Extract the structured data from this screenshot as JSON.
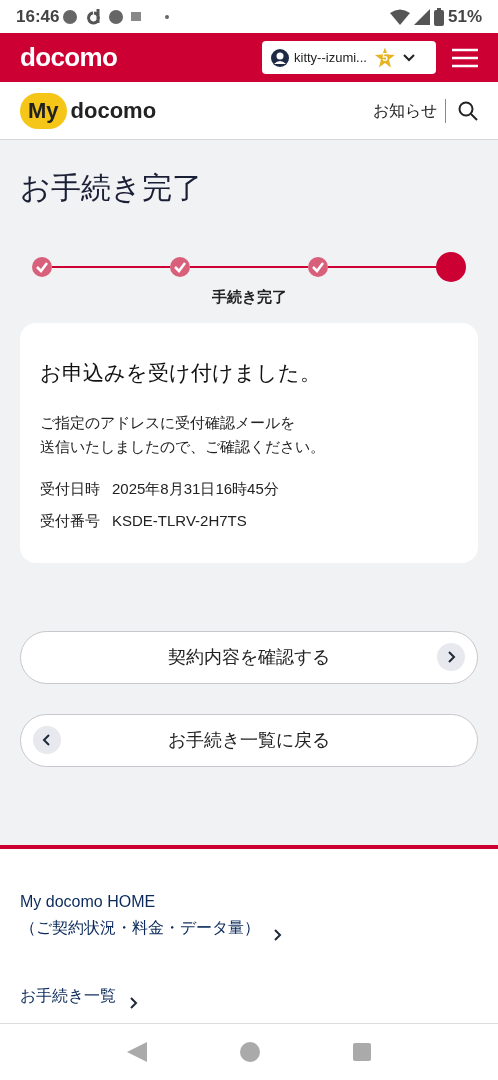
{
  "status_bar": {
    "time": "16:46",
    "battery": "51%"
  },
  "header": {
    "brand": "docomo",
    "account": {
      "name": "kitty--izumi...",
      "rank": "5"
    }
  },
  "subheader": {
    "logo_badge": "My",
    "logo_text": "docomo",
    "notice": "お知らせ"
  },
  "title": "お手続き完了",
  "stepper": {
    "steps": [
      {
        "kind": "done"
      },
      {
        "kind": "done"
      },
      {
        "kind": "done"
      },
      {
        "kind": "current"
      }
    ],
    "label": "手続き完了"
  },
  "card": {
    "heading": "お申込みを受け付けました。",
    "message": [
      "ご指定のアドレスに受付確認メールを",
      "送信いたしましたので、ご確認ください。"
    ],
    "fields": [
      {
        "label": "受付日時",
        "value": "2025年8月31日16時45分"
      },
      {
        "label": "受付番号",
        "value": "KSDE-TLRV-2H7TS"
      }
    ]
  },
  "buttons": [
    {
      "label": "契約内容を確認する",
      "kind": "forward"
    },
    {
      "label": "お手続き一覧に戻る",
      "kind": "back"
    }
  ],
  "footer_links": [
    "My docomo HOME\n（ご契約状況・料金・データ量）",
    "お手続き一覧"
  ]
}
